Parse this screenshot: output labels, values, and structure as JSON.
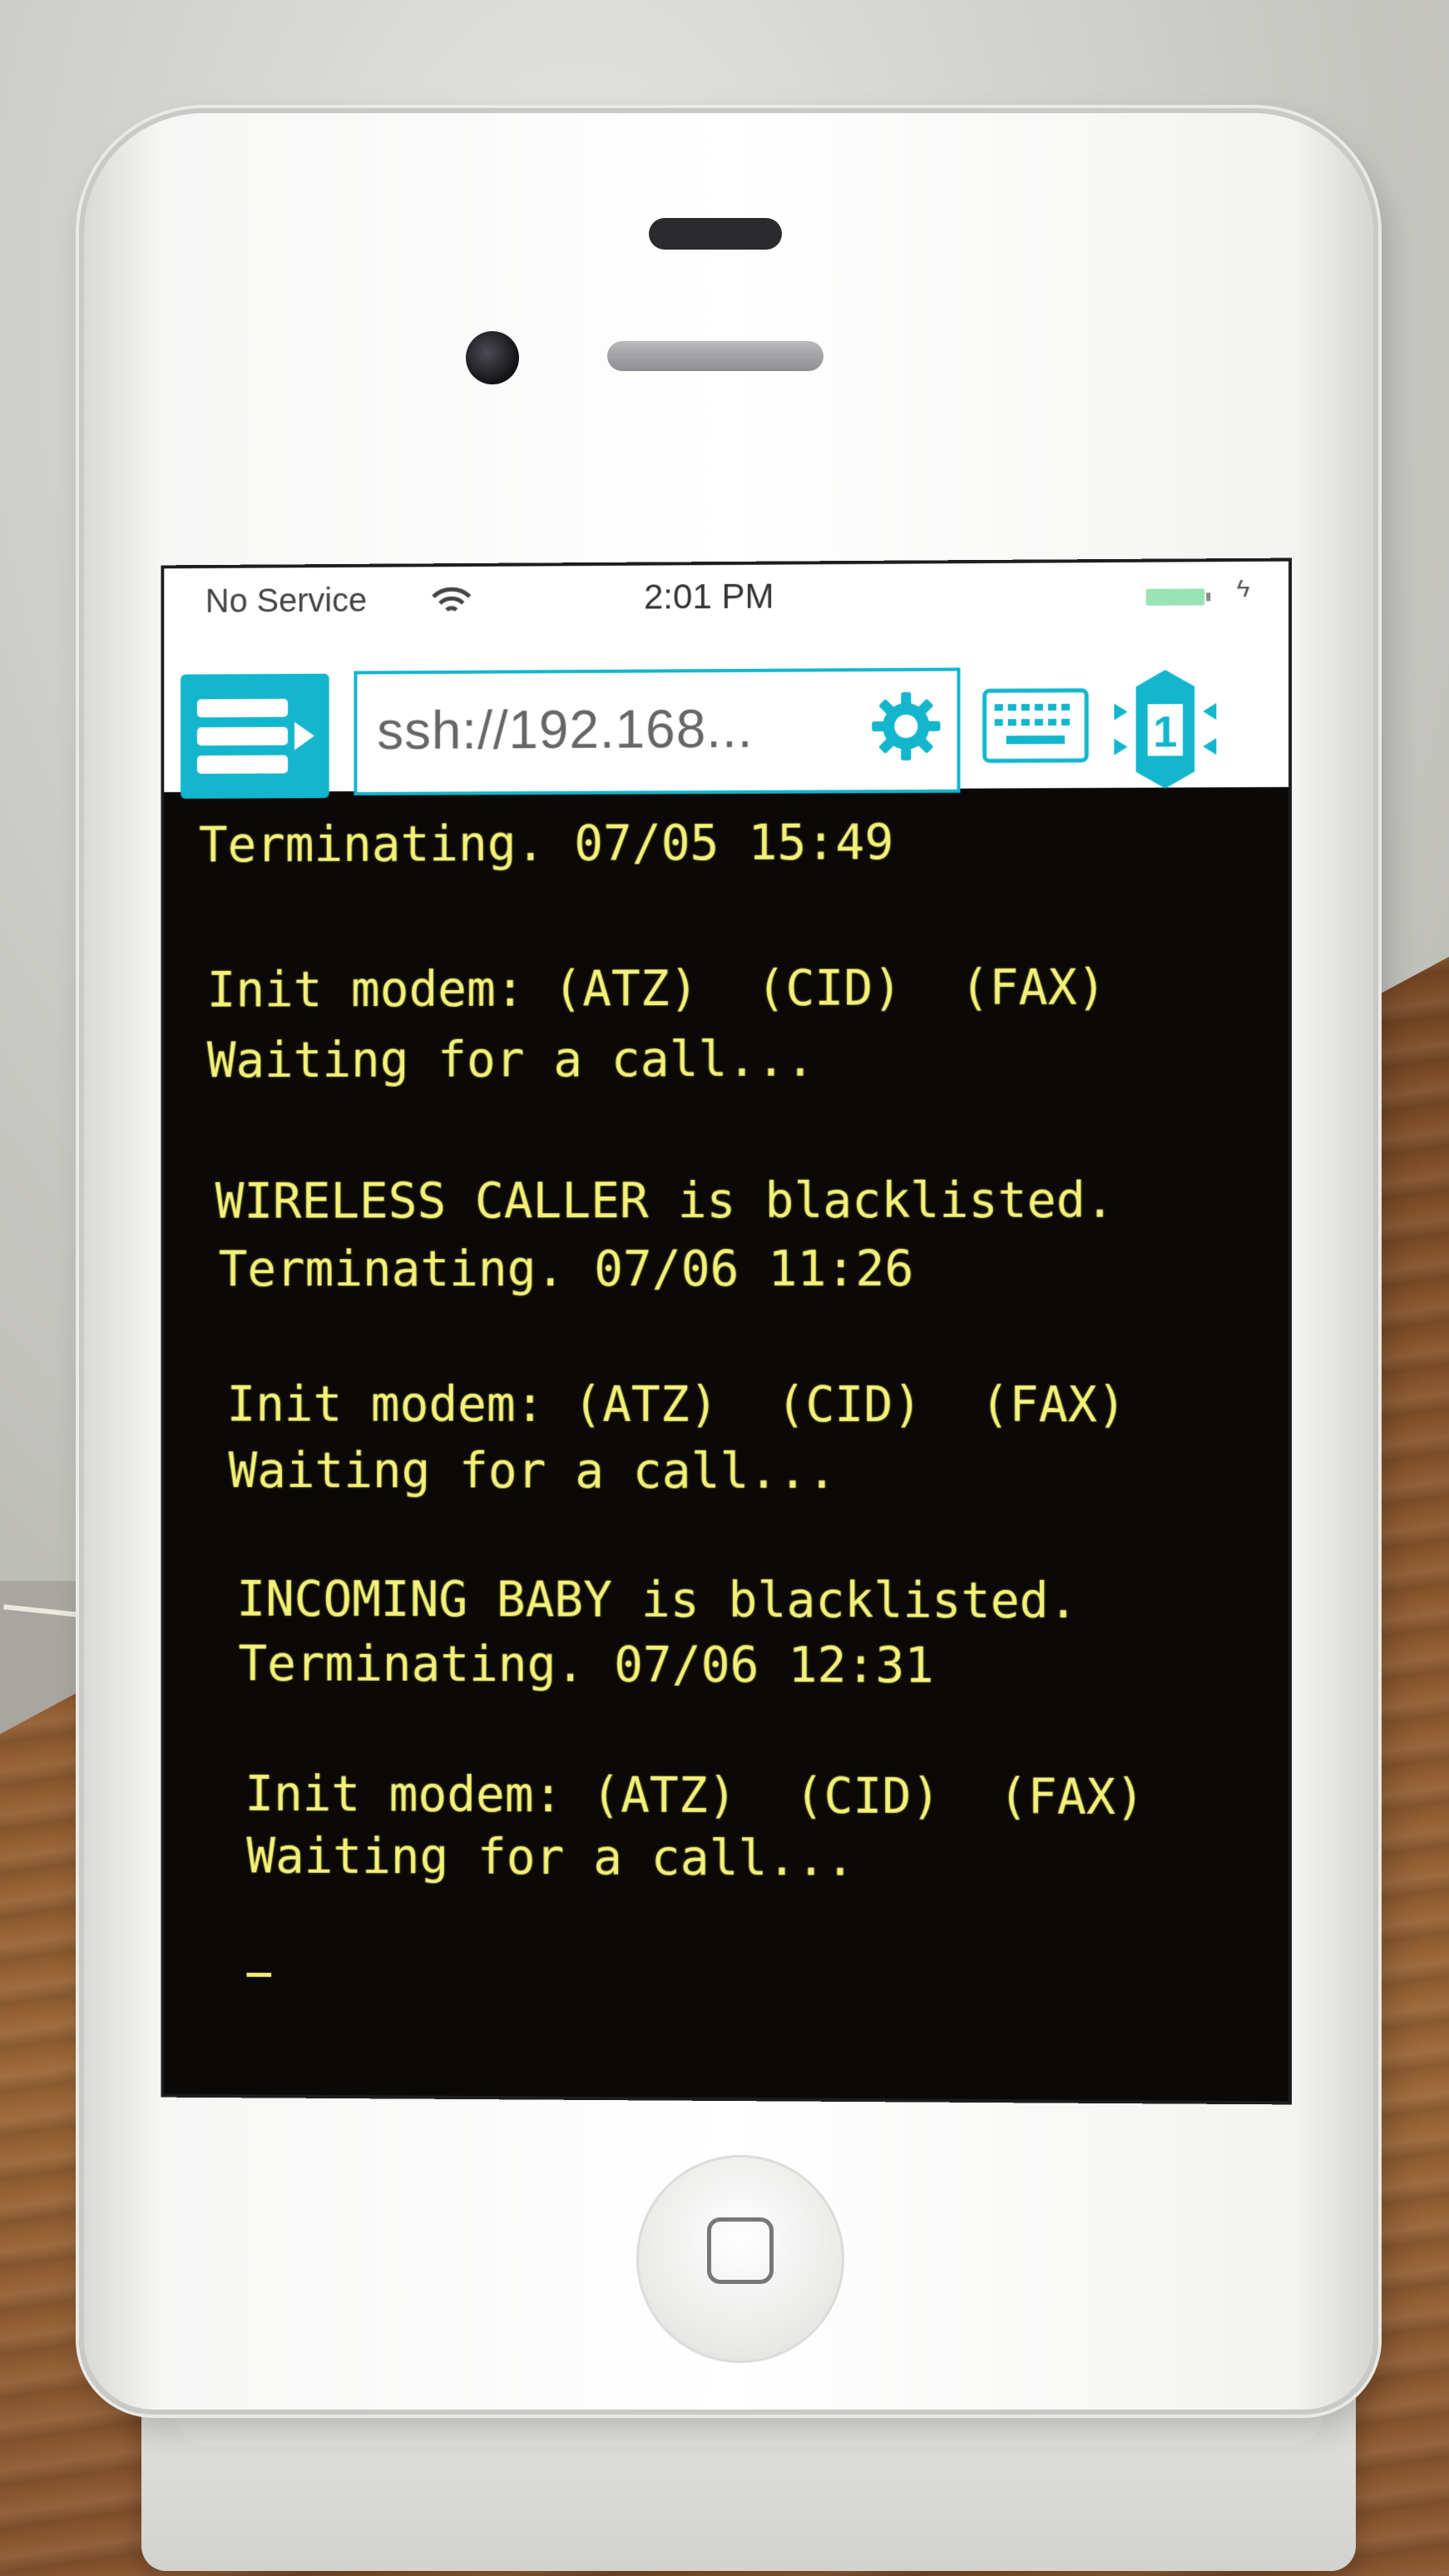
{
  "status_bar": {
    "carrier": "No Service",
    "time": "2:01 PM",
    "wifi_icon": "wifi-icon",
    "battery_icon": "battery-icon",
    "charge_icon": "charging-icon"
  },
  "toolbar": {
    "menu_icon": "menu-arrow-icon",
    "url": "ssh://192.168...",
    "settings_icon": "gear-icon",
    "keyboard_icon": "keyboard-icon",
    "session_number": "1"
  },
  "terminal": {
    "lines": [
      "Terminating. 07/05 15:49",
      "Init modem: (ATZ)  (CID)  (FAX)",
      "Waiting for a call...",
      "WIRELESS CALLER is blacklisted.",
      "Terminating. 07/06 11:26",
      "Init modem: (ATZ)  (CID)  (FAX)",
      "Waiting for a call...",
      "INCOMING BABY is blacklisted.",
      "Terminating. 07/06 12:31",
      "Init modem: (ATZ)  (CID)  (FAX)",
      "Waiting for a call..."
    ],
    "text_color": "#f3f178",
    "background": "#0a0907"
  },
  "colors": {
    "accent": "#13b6cc"
  }
}
